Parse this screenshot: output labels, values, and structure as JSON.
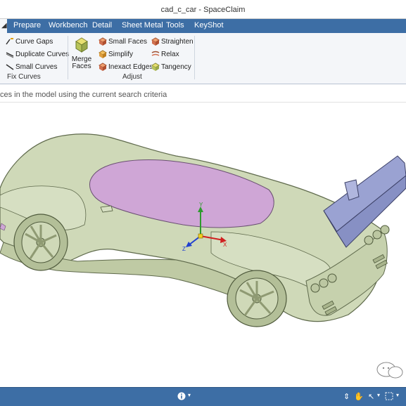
{
  "window": {
    "title": "cad_c_car - SpaceClaim"
  },
  "menu": {
    "tabs": [
      {
        "label": "Prepare"
      },
      {
        "label": "Workbench"
      },
      {
        "label": "Detail"
      },
      {
        "label": "Sheet Metal"
      },
      {
        "label": "Tools"
      },
      {
        "label": "KeyShot"
      }
    ]
  },
  "ribbon": {
    "fix_curves": {
      "curve_gaps": "Curve Gaps",
      "duplicate_curves": "Duplicate Curves",
      "small_curves": "Small Curves",
      "group_label": "Fix Curves"
    },
    "adjust": {
      "merge_faces": "Merge\nFaces",
      "small_faces": "Small Faces",
      "simplify": "Simplify",
      "inexact_edges": "Inexact Edges",
      "straighten": "Straighten",
      "relax": "Relax",
      "tangency": "Tangency",
      "group_label": "Adjust"
    }
  },
  "viewport": {
    "hint": "ces in the model using the current search criteria",
    "axes": {
      "x": "X",
      "y": "Y",
      "z": "Z"
    }
  },
  "colors": {
    "menubar": "#3d6ea5",
    "car_body": "#cfd9b8",
    "canopy": "#cfa6d6",
    "wing": "#9aa2d2"
  }
}
